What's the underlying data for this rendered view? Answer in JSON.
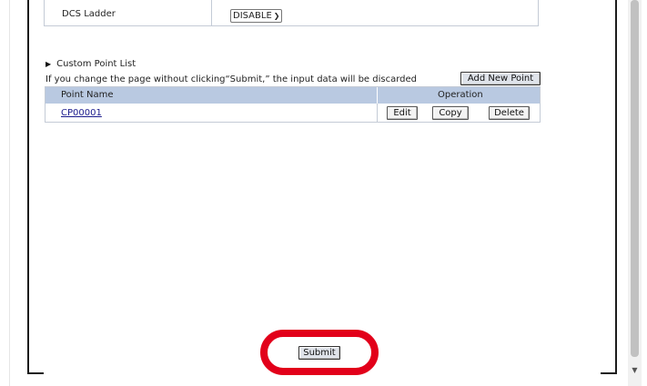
{
  "settings": {
    "dcs_ladder_label": "DCS Ladder",
    "dcs_ladder_value": "DISABLE"
  },
  "custom_points": {
    "section_title": "Custom Point List",
    "notice": "If you change the page without clicking“Submit,” the input data will be discarded",
    "add_button": "Add New Point",
    "columns": {
      "name": "Point Name",
      "operation": "Operation"
    },
    "rows": [
      {
        "name": "CP00001",
        "edit": "Edit",
        "copy": "Copy",
        "delete": "Delete"
      }
    ]
  },
  "footer": {
    "submit_label": "Submit"
  },
  "colors": {
    "highlight": "#e2001a",
    "table_header": "#b9c9e1",
    "link": "#1a1a8c"
  }
}
